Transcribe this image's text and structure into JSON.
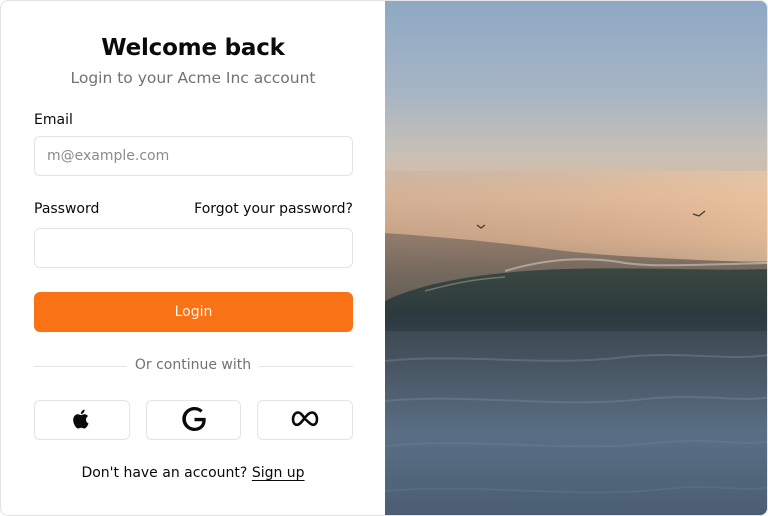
{
  "header": {
    "title": "Welcome back",
    "subtitle": "Login to your Acme Inc account"
  },
  "form": {
    "email_label": "Email",
    "email_placeholder": "m@example.com",
    "email_value": "",
    "password_label": "Password",
    "forgot_password": "Forgot your password?",
    "password_value": "",
    "login_button": "Login"
  },
  "divider": {
    "text": "Or continue with"
  },
  "social": [
    {
      "provider": "apple",
      "icon": "apple-icon"
    },
    {
      "provider": "google",
      "icon": "google-icon"
    },
    {
      "provider": "meta",
      "icon": "meta-icon"
    }
  ],
  "footer": {
    "prompt": "Don't have an account?",
    "signup_link": "Sign up"
  },
  "colors": {
    "accent": "#f97316",
    "border": "#e4e4e7",
    "muted_text": "#71717a"
  }
}
